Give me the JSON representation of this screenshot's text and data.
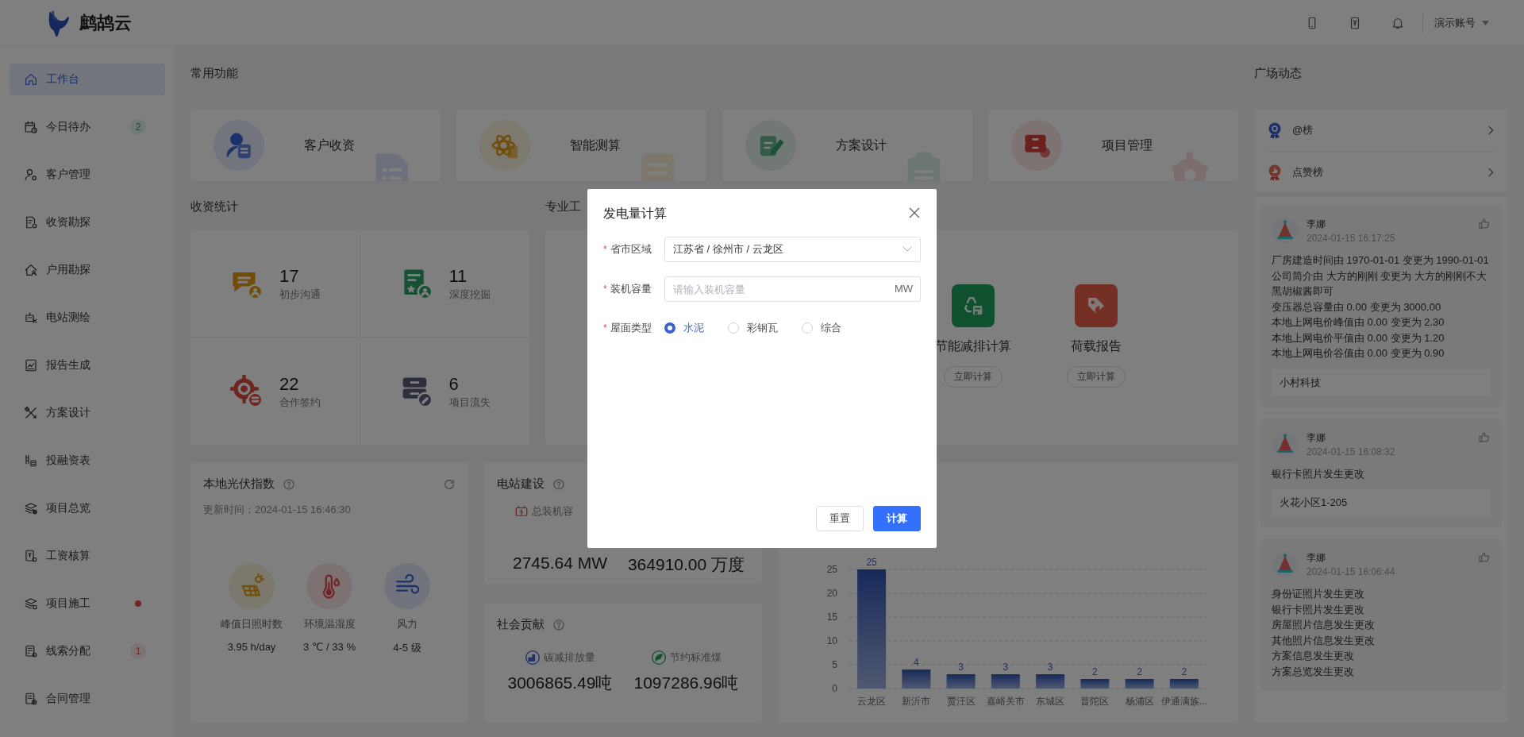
{
  "header": {
    "logo_text": "鹧鸪云",
    "account": "演示账号"
  },
  "sidebar": {
    "items": [
      {
        "label": "工作台",
        "selected": true
      },
      {
        "label": "今日待办",
        "selected": false,
        "badge": {
          "kind": "pill",
          "text": "2"
        }
      },
      {
        "label": "客户管理",
        "selected": false
      },
      {
        "label": "收资勘探",
        "selected": false
      },
      {
        "label": "户用勘探",
        "selected": false
      },
      {
        "label": "电站测绘",
        "selected": false
      },
      {
        "label": "报告生成",
        "selected": false
      },
      {
        "label": "方案设计",
        "selected": false
      },
      {
        "label": "投融资表",
        "selected": false
      },
      {
        "label": "项目总览",
        "selected": false
      },
      {
        "label": "工资核算",
        "selected": false
      },
      {
        "label": "项目施工",
        "selected": false,
        "badge": {
          "kind": "dot"
        }
      },
      {
        "label": "线索分配",
        "selected": false,
        "badge": {
          "kind": "alert",
          "text": "1"
        }
      },
      {
        "label": "合同管理",
        "selected": false
      }
    ]
  },
  "common_functions": {
    "title": "常用功能",
    "items": [
      {
        "label": "客户收资"
      },
      {
        "label": "智能测算"
      },
      {
        "label": "方案设计"
      },
      {
        "label": "项目管理"
      }
    ]
  },
  "stats": {
    "title": "收资统计",
    "items": [
      {
        "value": "17",
        "label": "初步沟通"
      },
      {
        "value": "11",
        "label": "深度挖掘"
      },
      {
        "value": "22",
        "label": "合作签约"
      },
      {
        "value": "6",
        "label": "项目流失"
      }
    ]
  },
  "tools": {
    "title": "专业工",
    "items": [
      {
        "label": "节能减排计算",
        "button": "立即计算"
      },
      {
        "label": "荷载报告",
        "button": "立即计算"
      }
    ]
  },
  "pv_index": {
    "title": "本地光伏指数",
    "updated": "更新时间：2024-01-15 16:46:30",
    "metrics": [
      {
        "label": "峰值日照时数",
        "value": "3.95 h/day"
      },
      {
        "label": "环境温湿度",
        "value": "3 ℃ / 33 %"
      },
      {
        "label": "风力",
        "value": "4-5 级"
      }
    ]
  },
  "station": {
    "title": "电站建设",
    "label": "总装机容",
    "values": [
      "2745.64 MW",
      "364910.00 万度"
    ]
  },
  "social": {
    "title": "社会贡献",
    "items": [
      {
        "label": "碳减排放量",
        "value": "3006865.49吨"
      },
      {
        "label": "节约标准煤",
        "value": "1097286.96吨"
      }
    ]
  },
  "region_chart": {
    "chart_data": {
      "type": "bar",
      "categories": [
        "云龙区",
        "新沂市",
        "贾汪区",
        "嘉峪关市",
        "东城区",
        "普陀区",
        "杨浦区",
        "伊通满族..."
      ],
      "values": [
        25,
        4,
        3,
        3,
        3,
        2,
        2,
        2
      ],
      "ylim": [
        0,
        25
      ],
      "yticks": [
        0,
        5,
        10,
        15,
        20,
        25
      ],
      "grid": true,
      "data_labels": true
    }
  },
  "square": {
    "title": "广场动态",
    "links": [
      {
        "label": "@榜"
      },
      {
        "label": "点赞榜"
      }
    ],
    "feed": [
      {
        "user": "李娜",
        "time": "2024-01-15 16:17:25",
        "lines": [
          "厂房建造时间由 1970-01-01 变更为 1990-01-01",
          "公司简介由 大方的刚刚 变更为 大方的刚刚不大黑胡椒酱即可",
          "变压器总容量由 0.00 变更为 3000.00",
          "本地上网电价峰值由 0.00 变更为 2.30",
          "本地上网电价平值由 0.00 变更为 1.20",
          "本地上网电价谷值由 0.00 变更为 0.90"
        ],
        "tag": "小村科技"
      },
      {
        "user": "李娜",
        "time": "2024-01-15 16:08:32",
        "lines": [
          "银行卡照片发生更改"
        ],
        "tag": "火花小区1-205"
      },
      {
        "user": "李娜",
        "time": "2024-01-15 16:06:44",
        "lines": [
          "身份证照片发生更改",
          "银行卡照片发生更改",
          "房屋照片信息发生更改",
          "其他照片信息发生更改",
          "方案信息发生更改",
          "方案总览发生更改"
        ]
      }
    ]
  },
  "modal": {
    "title": "发电量计算",
    "fields": [
      {
        "kind": "select",
        "required": "*",
        "label": "省市区域",
        "value": "江苏省 / 徐州市 / 云龙区"
      },
      {
        "kind": "input",
        "required": "*",
        "label": "装机容量",
        "placeholder": "请输入装机容量",
        "suffix": "MW"
      },
      {
        "kind": "radio",
        "required": "*",
        "label": "屋面类型",
        "options": [
          {
            "label": "水泥",
            "selected": true
          },
          {
            "label": "彩钢瓦",
            "selected": false
          },
          {
            "label": "综合",
            "selected": false
          }
        ]
      }
    ],
    "buttons": [
      {
        "label": "重置",
        "kind": "default"
      },
      {
        "label": "计算",
        "kind": "primary"
      }
    ]
  }
}
